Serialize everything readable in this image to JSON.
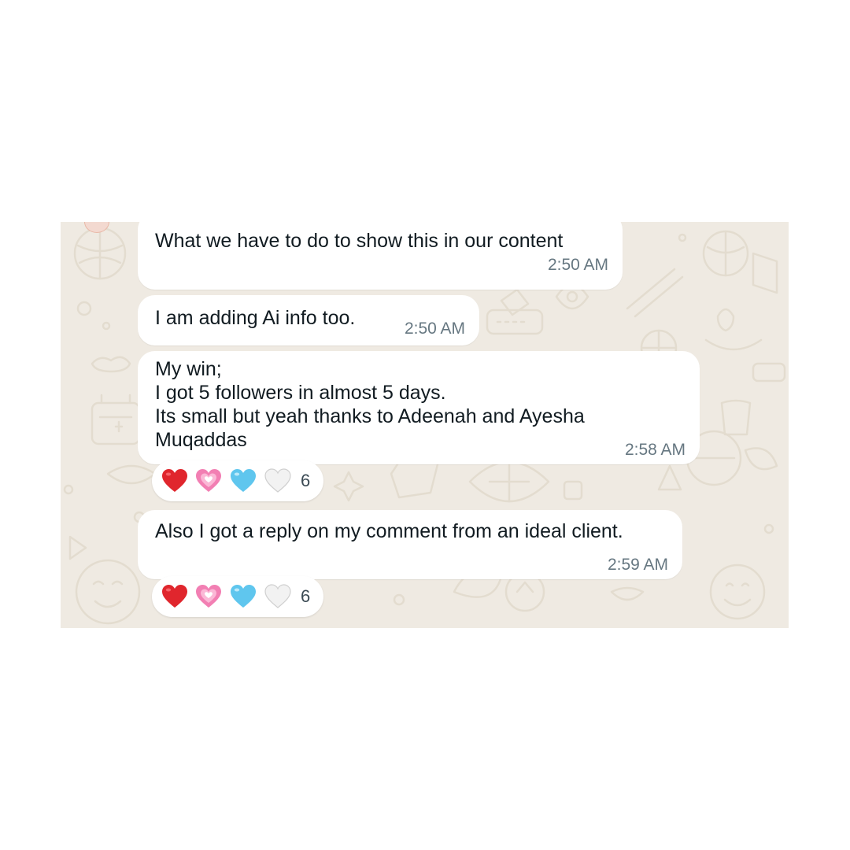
{
  "colors": {
    "chat_background": "#efeae2",
    "bubble_background": "#ffffff",
    "text": "#111b21",
    "timestamp": "#667781"
  },
  "messages": [
    {
      "text": "What we have to do to show this in our content",
      "time": "2:50 AM"
    },
    {
      "text": "I am adding Ai info too.",
      "time": "2:50 AM"
    },
    {
      "text": "My win;\nI got 5 followers in almost 5 days.\nIts small but yeah thanks to Adeenah and Ayesha\nMuqaddas",
      "time": "2:58 AM",
      "reactions": {
        "emojis": [
          "red-heart",
          "pink-sparkling-heart",
          "light-blue-heart",
          "white-heart"
        ],
        "count": "6"
      }
    },
    {
      "text": "Also I got a reply on my comment from an ideal client.",
      "time": "2:59 AM",
      "reactions": {
        "emojis": [
          "red-heart",
          "pink-sparkling-heart",
          "light-blue-heart",
          "white-heart"
        ],
        "count": "6"
      }
    }
  ]
}
